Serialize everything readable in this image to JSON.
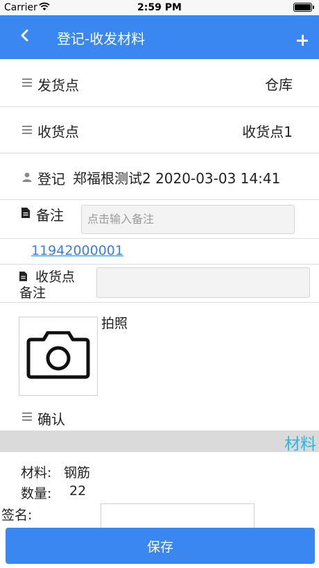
{
  "status_bar": {
    "carrier": "Carrier",
    "time": "2:59 PM"
  },
  "nav": {
    "title": "登记-收发材料",
    "back_icon": "chevron-left-icon",
    "add_icon": "plus-icon"
  },
  "form": {
    "ship_point": {
      "label": "发货点",
      "value": "仓库"
    },
    "receive_point": {
      "label": "收货点",
      "value": "收货点1"
    },
    "register": {
      "label": "登记",
      "value": "郑福根测试2 2020-03-03 14:41"
    },
    "remark": {
      "label": "备注",
      "placeholder": "点击输入备注"
    },
    "phone_link": "11942000001",
    "receive_remark": {
      "label_line1": "收货点",
      "label_line2": "备注",
      "value": ""
    },
    "photo": {
      "label": "拍照"
    },
    "confirm": {
      "label": "确认"
    }
  },
  "section": {
    "title": "材料"
  },
  "material": {
    "name_label": "材料:",
    "name_value": "钢筋",
    "qty_label": "数量:",
    "qty_value": "22",
    "sign_label": "签名:"
  },
  "footer": {
    "save_label": "保存"
  }
}
